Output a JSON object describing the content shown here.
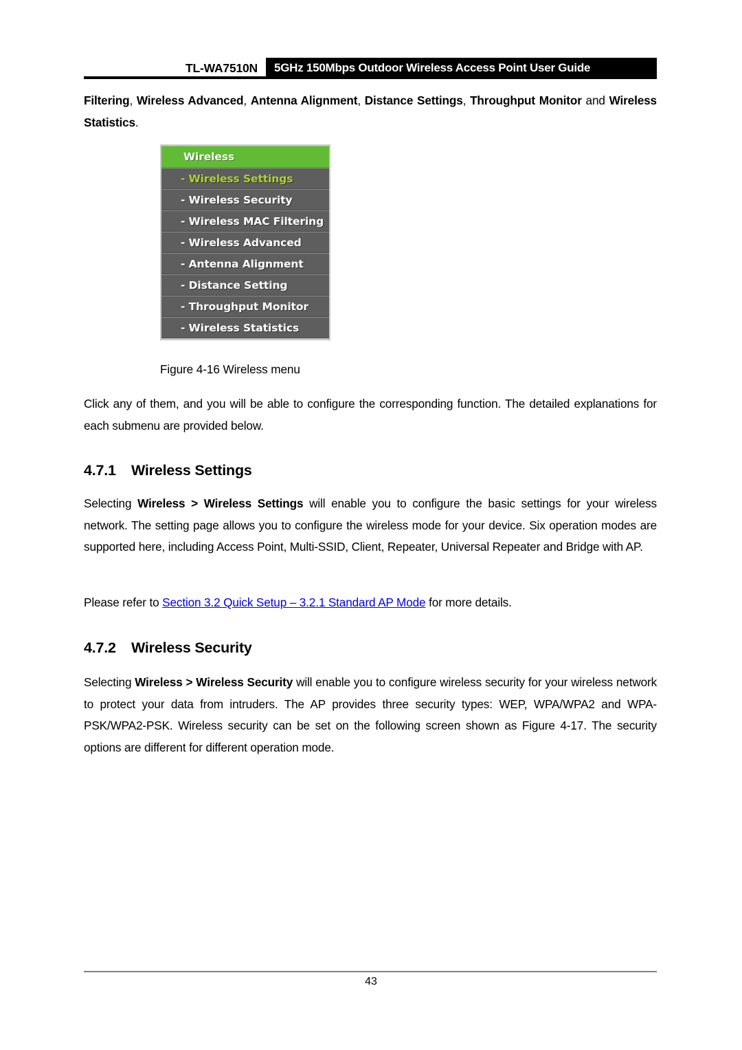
{
  "header": {
    "model": "TL-WA7510N",
    "title": "5GHz 150Mbps Outdoor Wireless Access Point User Guide"
  },
  "paragraphs": {
    "lead_html": "<b>Filtering</b>, <b>Wireless Advanced</b>, <b>Antenna Alignment</b>, <b>Distance Settings</b>, <b>Throughput Monitor</b> and <b>Wireless Statistics</b>.",
    "click_html": "Click any of them, and you will be able to configure the corresponding function. The detailed explanations for each submenu are provided below.",
    "settings_html": "Selecting <b>Wireless &gt; Wireless Settings</b> will enable you to configure the basic settings for your wireless network. The setting page allows you to configure the wireless mode for your device. Six operation modes are supported here, including Access Point, Multi-SSID, Client, Repeater, Universal Repeater and Bridge with AP.",
    "refer_prefix": "Please refer to ",
    "refer_link": "Section 3.2 Quick Setup – 3.2.1 Standard AP Mode",
    "refer_suffix": " for more details.",
    "security_html": "Selecting <b>Wireless &gt; Wireless Security</b> will enable you to configure wireless security for your wireless network to protect your data from intruders. The AP provides three security types: WEP, WPA/WPA2 and WPA-PSK/WPA2-PSK. Wireless security can be set on the following screen shown as Figure 4-17. The security options are different for different operation mode."
  },
  "headings": {
    "s471_number": "4.7.1",
    "s471_title": "Wireless Settings",
    "s472_number": "4.7.2",
    "s472_title": "Wireless Security"
  },
  "figure": {
    "caption": "Figure 4-16 Wireless menu",
    "menu": {
      "header_label": "Wireless",
      "header_color": "#62bb35",
      "item_color": "#5e5e5e",
      "active_text_color": "#a8d62a",
      "items": [
        {
          "label": "- Wireless Settings",
          "active": true
        },
        {
          "label": "- Wireless Security",
          "active": false
        },
        {
          "label": "- Wireless MAC Filtering",
          "active": false
        },
        {
          "label": "- Wireless Advanced",
          "active": false
        },
        {
          "label": "- Antenna Alignment",
          "active": false
        },
        {
          "label": "- Distance Setting",
          "active": false
        },
        {
          "label": "- Throughput Monitor",
          "active": false
        },
        {
          "label": "- Wireless Statistics",
          "active": false
        }
      ]
    }
  },
  "footer": {
    "page_number": "43"
  }
}
